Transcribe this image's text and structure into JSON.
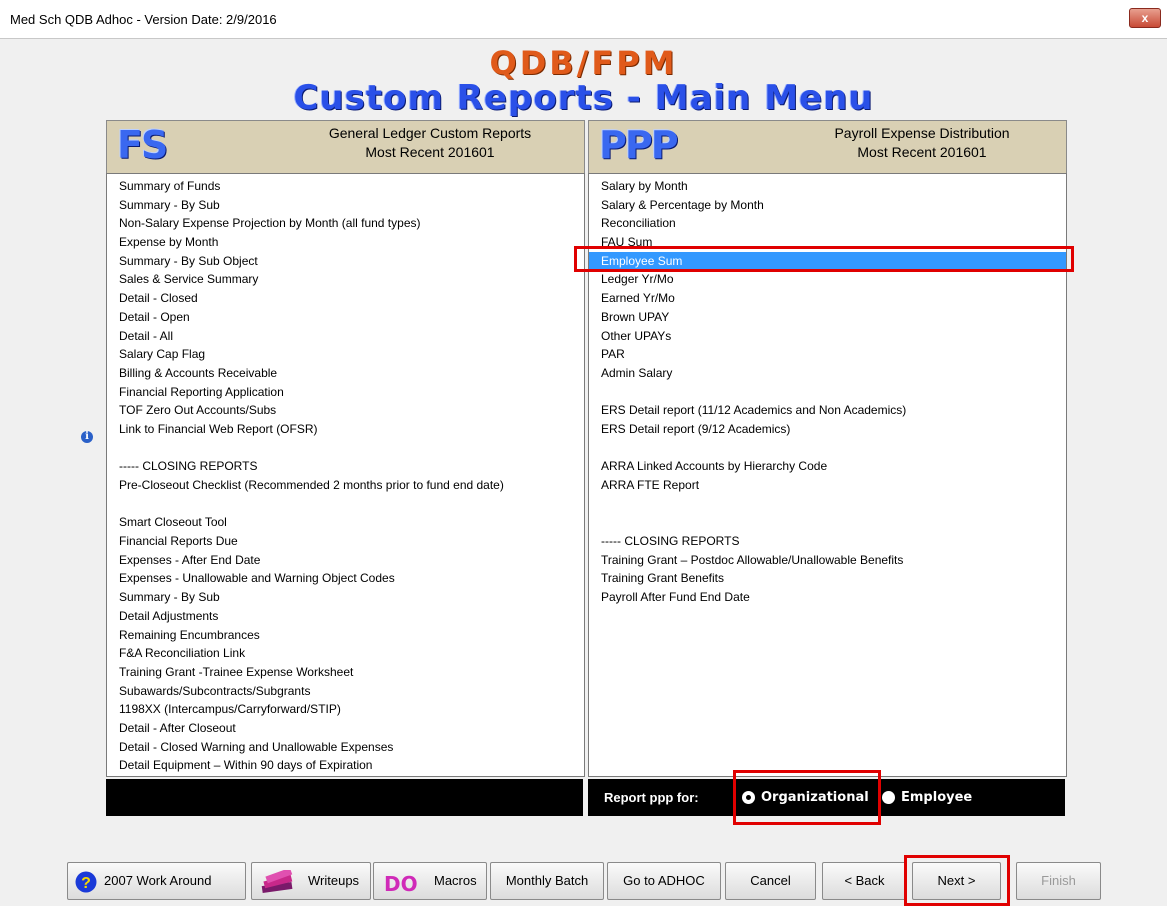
{
  "window": {
    "title": "Med Sch QDB Adhoc - Version Date: 2/9/2016",
    "close_label": "x"
  },
  "header": {
    "line1": "QDB/FPM",
    "line2": "Custom Reports - Main Menu"
  },
  "left_panel": {
    "logo": "FS",
    "title_line1": "General Ledger Custom Reports",
    "title_line2": "Most Recent 201601",
    "items": [
      "Summary of Funds",
      "Summary - By Sub",
      "Non-Salary Expense Projection by Month (all fund types)",
      "Expense by Month",
      "Summary - By Sub Object",
      "Sales & Service Summary",
      "Detail - Closed",
      "Detail - Open",
      "Detail - All",
      "Salary Cap Flag",
      "Billing & Accounts Receivable",
      "Financial Reporting Application",
      "TOF Zero Out Accounts/Subs",
      "Link to Financial Web Report (OFSR)",
      "",
      "----- CLOSING REPORTS",
      "Pre-Closeout Checklist (Recommended 2 months prior to fund end date)",
      "",
      "Smart Closeout Tool",
      "Financial Reports Due",
      "Expenses - After End Date",
      "Expenses - Unallowable and Warning Object Codes",
      "Summary - By Sub",
      "Detail Adjustments",
      "Remaining Encumbrances",
      "F&A Reconciliation Link",
      "Training Grant -Trainee Expense Worksheet",
      "Subawards/Subcontracts/Subgrants",
      "1198XX (Intercampus/Carryforward/STIP)",
      "Detail - After Closeout",
      "Detail - Closed Warning and Unallowable Expenses",
      "Detail Equipment – Within 90 days of Expiration"
    ]
  },
  "right_panel": {
    "logo": "PPP",
    "title_line1": "Payroll Expense Distribution",
    "title_line2": "Most Recent 201601",
    "selected_index": 4,
    "items": [
      "Salary by Month",
      "Salary & Percentage by Month",
      "Reconciliation",
      "FAU Sum",
      "Employee Sum",
      "Ledger Yr/Mo",
      "Earned Yr/Mo",
      "Brown UPAY",
      "Other UPAYs",
      "PAR",
      "Admin Salary",
      "",
      "ERS Detail report (11/12 Academics and Non Academics)",
      "ERS Detail report (9/12 Academics)",
      "",
      "ARRA Linked Accounts by Hierarchy Code",
      "ARRA FTE Report",
      "",
      "",
      "----- CLOSING REPORTS",
      "Training Grant – Postdoc Allowable/Unallowable Benefits",
      "Training Grant Benefits",
      "Payroll After Fund End Date"
    ]
  },
  "report_for": {
    "label": "Report  ppp for:",
    "options": [
      "Organizational",
      "Employee"
    ],
    "selected": "Organizational"
  },
  "buttons": {
    "work_around": "2007 Work Around",
    "writeups": "Writeups",
    "macros_icon": "DO",
    "macros": "Macros",
    "monthly_batch": "Monthly Batch",
    "goto_adhoc": "Go to ADHOC",
    "cancel": "Cancel",
    "back": "< Back",
    "next": "Next >",
    "finish": "Finish"
  },
  "colors": {
    "selection": "#3399ff",
    "highlight_box": "#e00000",
    "title_orange": "#e05a1a",
    "title_blue": "#2a50e8"
  }
}
